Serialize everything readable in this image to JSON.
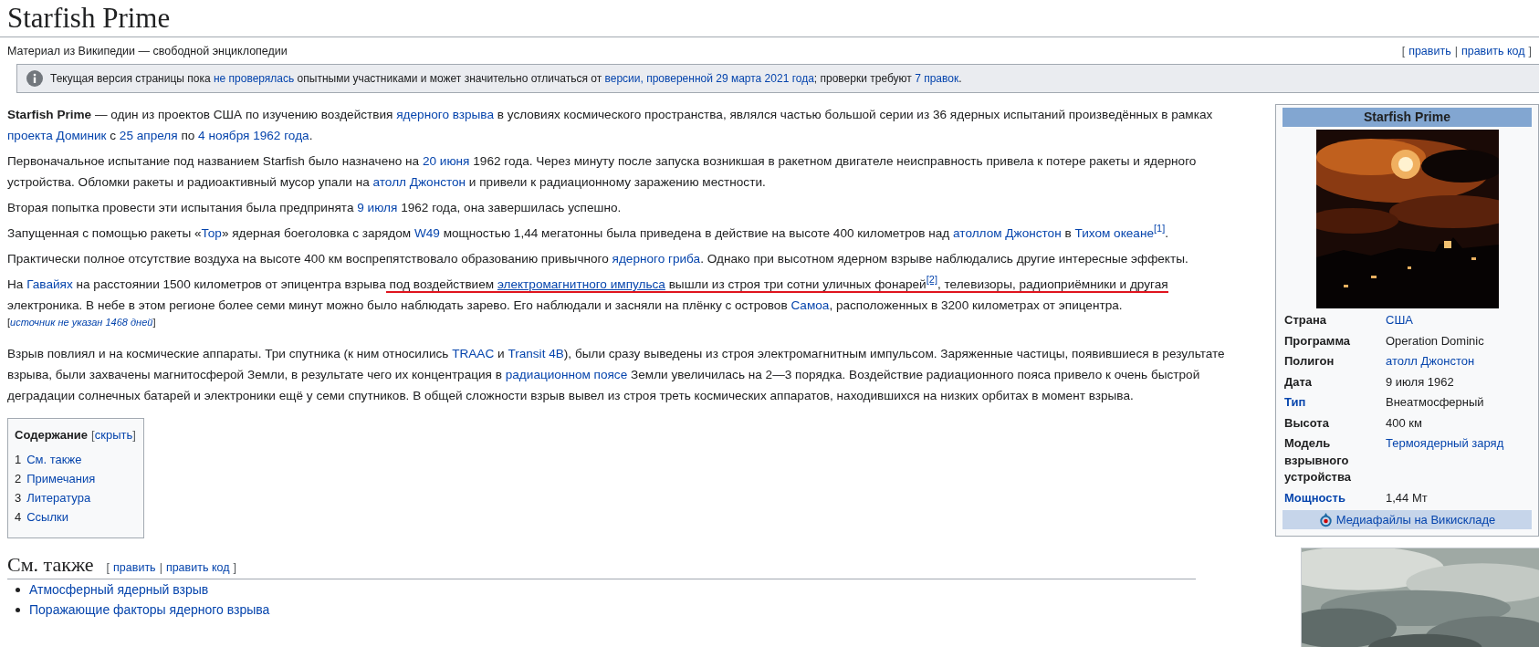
{
  "page_title": "Starfish Prime",
  "tagline": "Материал из Википедии — свободной энциклопедии",
  "edit_links": {
    "open": "[",
    "separator": "|",
    "close": "]",
    "links": [
      "править",
      "править код"
    ]
  },
  "notice": {
    "segments": [
      {
        "kind": "text",
        "text": "Текущая версия страницы пока "
      },
      {
        "kind": "link",
        "text": "не проверялась"
      },
      {
        "kind": "text",
        "text": " опытными участниками и может значительно отличаться от "
      },
      {
        "kind": "link",
        "text": "версии, проверенной 29 марта 2021 года"
      },
      {
        "kind": "text",
        "text": "; проверки требуют "
      },
      {
        "kind": "link",
        "text": "7 правок"
      },
      {
        "kind": "text",
        "text": "."
      }
    ]
  },
  "paragraphs": [
    {
      "kind": "normal",
      "segments": [
        {
          "kind": "bold",
          "text": "Starfish Prime"
        },
        {
          "kind": "text",
          "text": " — один из проектов США по изучению воздействия "
        },
        {
          "kind": "link",
          "text": "ядерного взрыва"
        },
        {
          "kind": "text",
          "text": " в условиях космического пространства, являлся частью большой серии из 36 ядерных испытаний произведённых в рамках "
        },
        {
          "kind": "link",
          "text": "проекта Доминик"
        },
        {
          "kind": "text",
          "text": " с "
        },
        {
          "kind": "link",
          "text": "25 апреля"
        },
        {
          "kind": "text",
          "text": " по "
        },
        {
          "kind": "link",
          "text": "4 ноября 1962 года"
        },
        {
          "kind": "text",
          "text": "."
        }
      ]
    },
    {
      "kind": "normal",
      "segments": [
        {
          "kind": "text",
          "text": "Первоначальное испытание под названием Starfish было назначено на "
        },
        {
          "kind": "link",
          "text": "20 июня"
        },
        {
          "kind": "text",
          "text": " 1962 года. Через минуту после запуска возникшая в ракетном двигателе неисправность привела к потере ракеты и ядерного устройства. Обломки ракеты и радиоактивный мусор упали на "
        },
        {
          "kind": "link",
          "text": "атолл Джонстон"
        },
        {
          "kind": "text",
          "text": " и привели к радиационному заражению местности."
        }
      ]
    },
    {
      "kind": "normal",
      "segments": [
        {
          "kind": "text",
          "text": "Вторая попытка провести эти испытания была предпринята "
        },
        {
          "kind": "link",
          "text": "9 июля"
        },
        {
          "kind": "text",
          "text": " 1962 года, она завершилась успешно."
        }
      ]
    },
    {
      "kind": "normal",
      "segments": [
        {
          "kind": "text",
          "text": "Запущенная с помощью ракеты «"
        },
        {
          "kind": "link",
          "text": "Тор"
        },
        {
          "kind": "text",
          "text": "» ядерная боеголовка с зарядом "
        },
        {
          "kind": "link",
          "text": "W49"
        },
        {
          "kind": "text",
          "text": " мощностью 1,44 мегатонны была приведена в действие на высоте 400 километров над "
        },
        {
          "kind": "link",
          "text": "атоллом Джонстон"
        },
        {
          "kind": "text",
          "text": " в "
        },
        {
          "kind": "link",
          "text": "Тихом океане"
        },
        {
          "kind": "ref",
          "text": "[1]"
        },
        {
          "kind": "text",
          "text": "."
        }
      ]
    },
    {
      "kind": "normal",
      "segments": [
        {
          "kind": "text",
          "text": "Практически полное отсутствие воздуха на высоте 400 км воспрепятствовало образованию привычного "
        },
        {
          "kind": "link",
          "text": "ядерного гриба"
        },
        {
          "kind": "text",
          "text": ". Однако при высотном ядерном взрыве наблюдались другие интересные эффекты."
        }
      ]
    },
    {
      "kind": "normal",
      "segments": [
        {
          "kind": "text",
          "text": "На ",
          "underlined": false
        },
        {
          "kind": "link",
          "text": "Гавайях",
          "underlined": false
        },
        {
          "kind": "text",
          "text": " на расстоянии 1500 километров от эпицентра взрыва",
          "underlined": false
        },
        {
          "kind": "text",
          "text": " под воздействием ",
          "underlined": true
        },
        {
          "kind": "link",
          "text": "электромагнитного импульса",
          "underlined": true
        },
        {
          "kind": "text",
          "text": " вышли из строя три сотни уличных фонарей",
          "underlined": true
        },
        {
          "kind": "ref",
          "text": "[2]",
          "underlined": true
        },
        {
          "kind": "text",
          "text": ", телевизоры, радиоприёмники и другая",
          "underlined": true
        },
        {
          "kind": "text",
          "text": " электроника. В небе в этом регионе более семи минут можно было наблюдать зарево. Его наблюдали и засняли на плёнку с островов ",
          "underlined": false
        },
        {
          "kind": "link",
          "text": "Самоа",
          "underlined": false
        },
        {
          "kind": "text",
          "text": ", расположенных в 3200 километрах от эпицентра.",
          "underlined": false
        }
      ]
    },
    {
      "kind": "note",
      "segments": [
        {
          "kind": "text",
          "text": "["
        },
        {
          "kind": "italic_link",
          "text": "источник не указан 1468 дней"
        },
        {
          "kind": "text",
          "text": "]"
        }
      ]
    },
    {
      "kind": "normal",
      "segments": [
        {
          "kind": "text",
          "text": "Взрыв повлиял и на космические аппараты. Три спутника (к ним относились "
        },
        {
          "kind": "link",
          "text": "TRAAC"
        },
        {
          "kind": "text",
          "text": " и "
        },
        {
          "kind": "link",
          "text": "Transit 4B"
        },
        {
          "kind": "text",
          "text": "), были сразу выведены из строя электромагнитным импульсом. Заряженные частицы, появившиеся в результате взрыва, были захвачены магнитосферой Земли, в результате чего их концентрация в "
        },
        {
          "kind": "link",
          "text": "радиационном поясе"
        },
        {
          "kind": "text",
          "text": " Земли увеличилась на 2—3 порядка. Воздействие радиационного пояса привело к очень быстрой деградации солнечных батарей и электроники ещё у семи спутников. В общей сложности взрыв вывел из строя треть космических аппаратов, находившихся на низких орбитах в момент взрыва."
        }
      ]
    }
  ],
  "toc": {
    "title": "Содержание",
    "open": "[",
    "toggle": "скрыть",
    "close": "]",
    "items": [
      {
        "number": "1",
        "label": "См. также"
      },
      {
        "number": "2",
        "label": "Примечания"
      },
      {
        "number": "3",
        "label": "Литература"
      },
      {
        "number": "4",
        "label": "Ссылки"
      }
    ]
  },
  "sections": [
    {
      "heading": "См. также",
      "edit_links": {
        "open": "[",
        "separator": "|",
        "close": "]",
        "links": [
          "править",
          "править код"
        ]
      },
      "items": [
        "Атмосферный ядерный взрыв",
        "Поражающие факторы ядерного взрыва"
      ]
    }
  ],
  "infobox": {
    "title": "Starfish Prime",
    "rows": [
      {
        "label": "Страна",
        "label_link": false,
        "value": "США",
        "value_link": true
      },
      {
        "label": "Программа",
        "label_link": false,
        "value": "Operation Dominic",
        "value_link": false
      },
      {
        "label": "Полигон",
        "label_link": false,
        "value": "атолл Джонстон",
        "value_link": true
      },
      {
        "label": "Дата",
        "label_link": false,
        "value": "9 июля 1962",
        "value_link": false
      },
      {
        "label": "Тип",
        "label_link": true,
        "value": "Внеатмосферный",
        "value_link": false
      },
      {
        "label": "Высота",
        "label_link": false,
        "value": "400 км",
        "value_link": false
      },
      {
        "label": "Модель взрывного устройства",
        "label_link": false,
        "value": "Термоядерный заряд",
        "value_link": true
      },
      {
        "label": "Мощность",
        "label_link": true,
        "value": "1,44 Мт",
        "value_link": false
      }
    ],
    "footer": "Медиафайлы на Викискладе"
  }
}
